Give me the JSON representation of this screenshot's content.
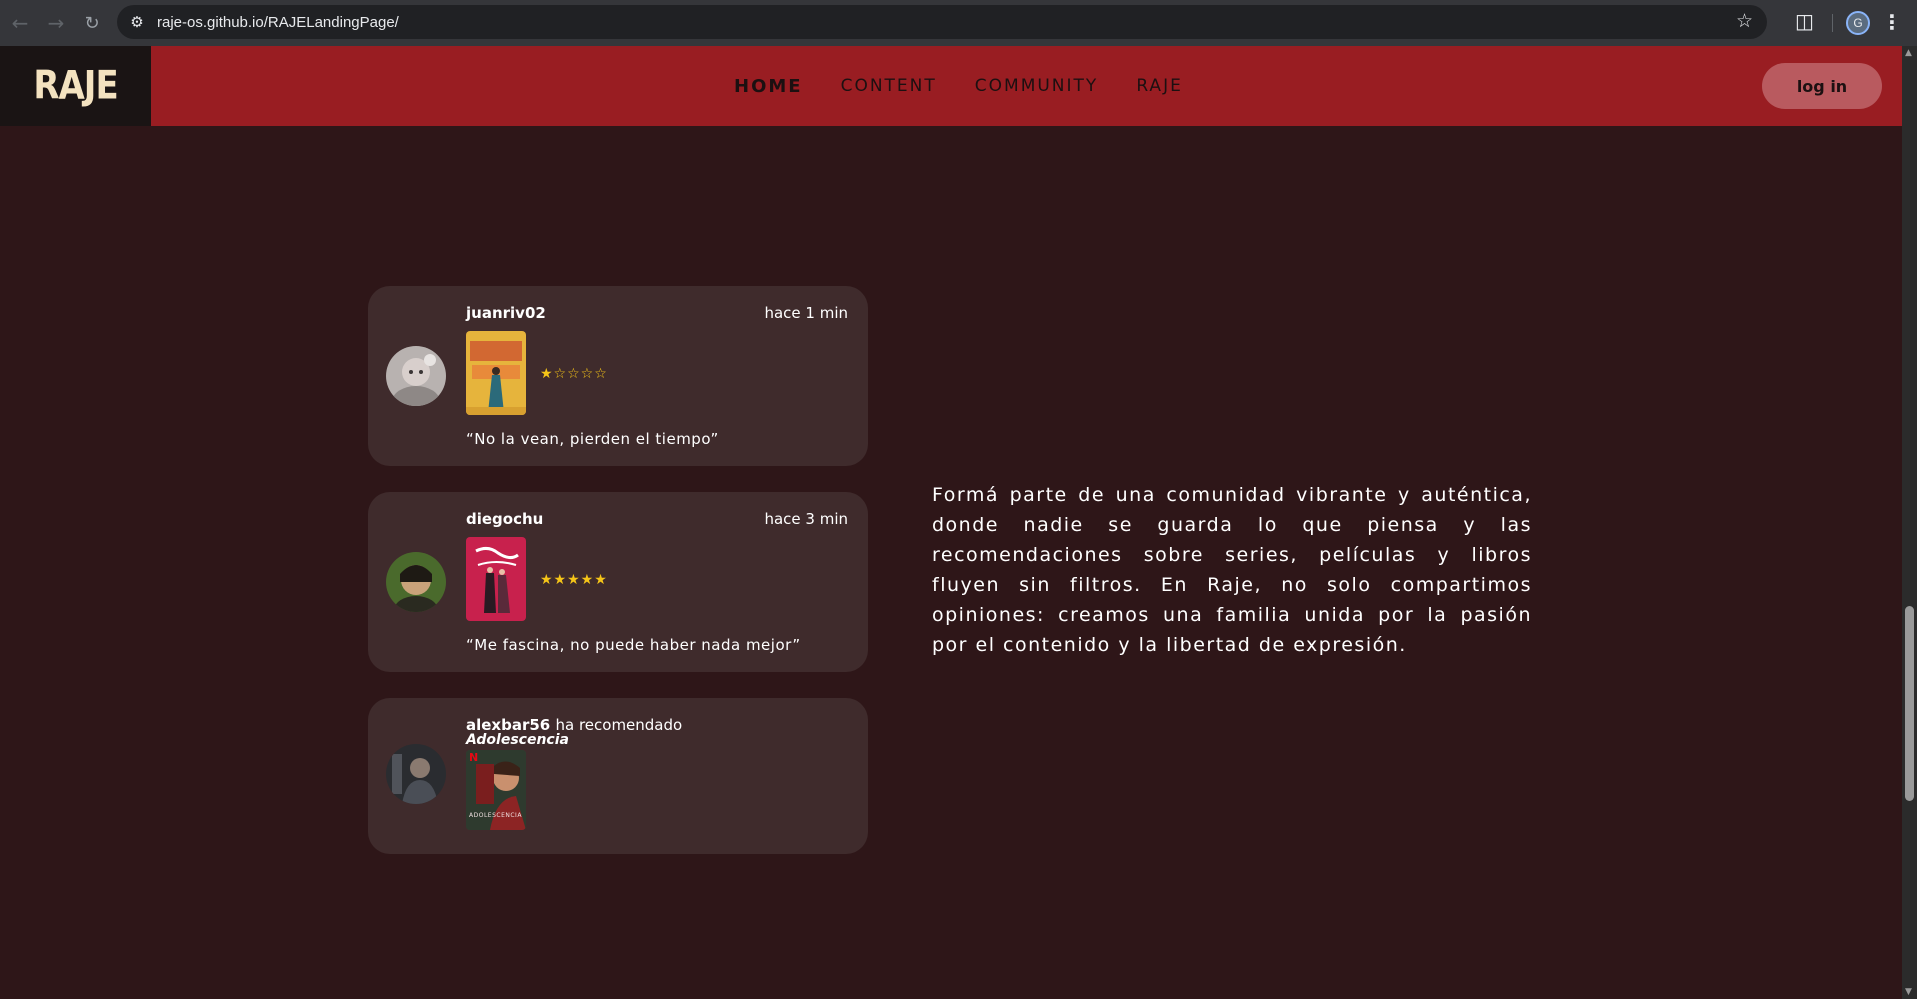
{
  "browser": {
    "url": "raje-os.github.io/RAJELandingPage/",
    "back_icon": "back-arrow-icon",
    "forward_icon": "forward-arrow-icon",
    "reload_icon": "reload-icon",
    "profile_initial": "G"
  },
  "header": {
    "logo": "RAJE",
    "nav": [
      {
        "label": "HOME",
        "active": true
      },
      {
        "label": "CONTENT",
        "active": false
      },
      {
        "label": "COMMUNITY",
        "active": false
      },
      {
        "label": "RAJE",
        "active": false
      }
    ],
    "login_label": "log in"
  },
  "colors": {
    "background": "#2e1618",
    "header": "#991d22",
    "card": "#3f2b2c",
    "login": "#b95a5f",
    "stars": "#f5c518"
  },
  "feed": {
    "posts": [
      {
        "username": "juanriv02",
        "time": "hace 1 min",
        "stars": "★☆☆☆☆",
        "rating": 1,
        "quote": "“No la vean, pierden el tiempo”"
      },
      {
        "username": "diegochu",
        "time": "hace 3 min",
        "stars": "★★★★★",
        "rating": 5,
        "quote": "“Me fascina, no puede haber nada mejor”"
      },
      {
        "username": "alexbar56",
        "action": "ha recomendado",
        "title": "Adolescencia",
        "poster_caption": "ADOLESCENCIA",
        "poster_badge": "N"
      }
    ]
  },
  "community": {
    "text": "Formá parte de una comunidad vibrante y auténtica, donde nadie se guarda lo que piensa y las recomendaciones sobre series, películas y libros fluyen sin filtros. En Raje, no solo compartimos opiniones: creamos una familia unida por la pasión por el contenido y la libertad de expresión."
  }
}
